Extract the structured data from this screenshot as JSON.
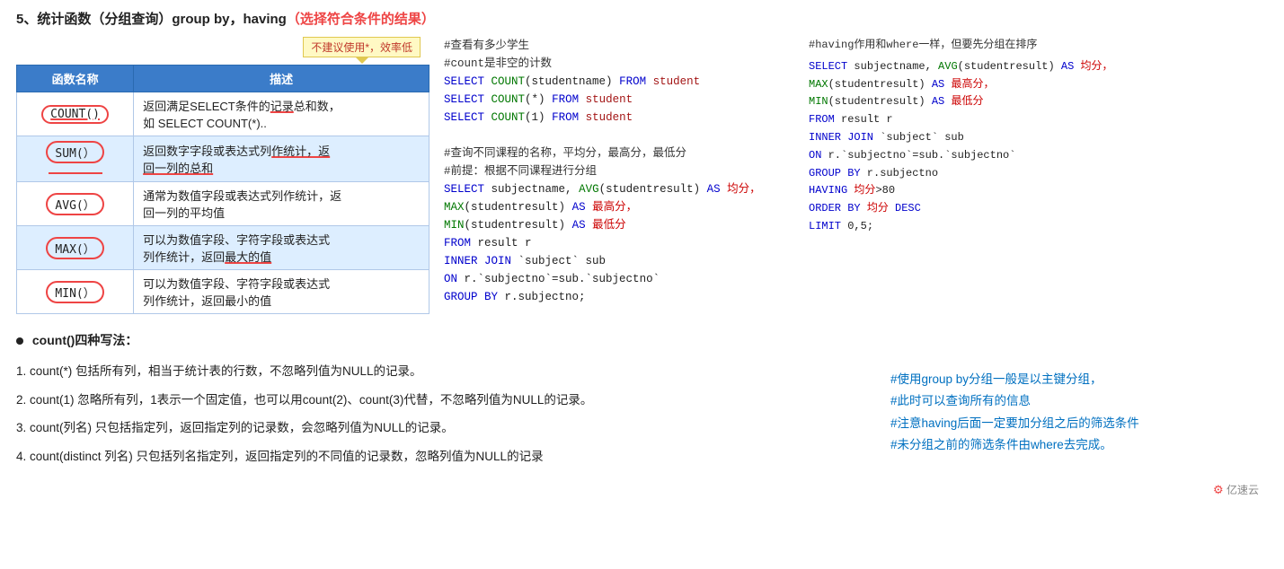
{
  "title": {
    "main": "5、统计函数（分组查询）group by，having",
    "highlight": "（选择符合条件的结果）"
  },
  "warning": {
    "text": "不建议使用*，效率低"
  },
  "table": {
    "headers": [
      "函数名称",
      "描述"
    ],
    "rows": [
      {
        "name": "COUNT()",
        "desc": "返回满足SELECT条件的记录总和数，如 SELECT COUNT(*).. "
      },
      {
        "name": "SUM(）",
        "desc": "返回数字字段或表达式列作统计，返回一列的总和"
      },
      {
        "name": "AVG(）",
        "desc": "通常为数值字段或表达式列作统计，返回一列的平均值"
      },
      {
        "name": "MAX(）",
        "desc": "可以为数值字段、字符字段或表达式列作统计，返回最大的值"
      },
      {
        "name": "MIN(）",
        "desc": "可以为数值字段、字符字段或表达式列作统计，返回最小的值"
      }
    ]
  },
  "middle_code": {
    "section1_comment": "#查看有多少学生",
    "section1_comment2": "#count是非空的计数",
    "section1_lines": [
      "SELECT COUNT(studentname) FROM student",
      "SELECT COUNT(*) FROM student",
      "SELECT COUNT(1) FROM student"
    ],
    "section2_comment": "#查询不同课程的名称，平均分，最高分，最低分",
    "section2_comment2": "#前提：根据不同课程进行分组",
    "section2_lines": [
      "SELECT subjectname, AVG(studentresult) AS 均分，",
      "MAX(studentresult) AS 最高分，",
      "MIN(studentresult) AS 最低分",
      "FROM result r",
      "INNER JOIN `subject` sub",
      "ON r.`subjectno`=sub.`subjectno`",
      "GROUP BY r.subjectno;"
    ]
  },
  "right_code": {
    "comment1": "#having作用和where一样，但要先分组在排序",
    "lines": [
      "SELECT subjectname, AVG(studentresult) AS 均分，",
      "MAX(studentresult) AS 最高分，",
      "MIN(studentresult) AS 最低分",
      "FROM result r",
      "INNER JOIN `subject` sub",
      "ON r.`subjectno`=sub.`subjectno`",
      "GROUP BY r.subjectno",
      "HAVING 均分>80",
      "ORDER BY 均分 DESC",
      "LIMIT 0,5;"
    ]
  },
  "bullet_title": "count()四种写法：",
  "count_items": [
    {
      "num": "1.",
      "text": "count(*) 包括所有列，相当于统计表的行数，不忽略列值为NULL的记录。"
    },
    {
      "num": "2.",
      "text": "count(1) 忽略所有列，1表示一个固定值，也可以用count(2)、count(3)代替，不忽略列值为NULL的记录。"
    },
    {
      "num": "3.",
      "text": "count(列名) 只包括指定列，返回指定列的记录数，会忽略列值为NULL的记录。"
    },
    {
      "num": "4.",
      "text": "count(distinct 列名) 只包括列名指定列，返回指定列的不同值的记录数，忽略列值为NULL的记录"
    }
  ],
  "right_note": {
    "line1": "#使用group by分组一般是以主键分组，",
    "line2": "#此时可以查询所有的信息",
    "line3": "#注意having后面一定要加分组之后的筛选条件",
    "line4": "#未分组之前的筛选条件由where去完成。"
  },
  "logo": "亿速云"
}
